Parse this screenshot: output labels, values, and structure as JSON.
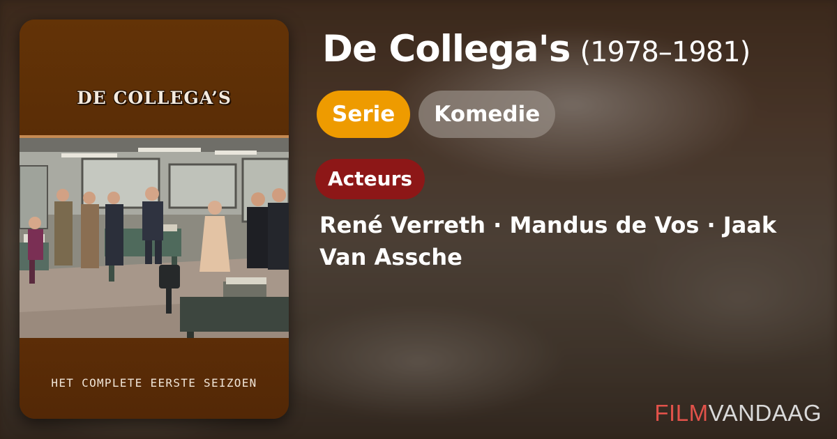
{
  "poster": {
    "title": "DE COLLEGA’S",
    "subtitle": "HET COMPLETE EERSTE SEIZOEN"
  },
  "header": {
    "title": "De Collega's",
    "year": "(1978–1981)"
  },
  "tags": {
    "type": "Serie",
    "genre": "Komedie"
  },
  "cast": {
    "section_label": "Acteurs",
    "names": "René Verreth · Mandus de Vos · Jaak Van Assche"
  },
  "brand": {
    "part1": "FILM",
    "part2": "VANDAAG"
  },
  "colors": {
    "serie_chip": "#ee9b00",
    "actors_badge": "#8d1717",
    "brand_accent": "#e2524a"
  }
}
